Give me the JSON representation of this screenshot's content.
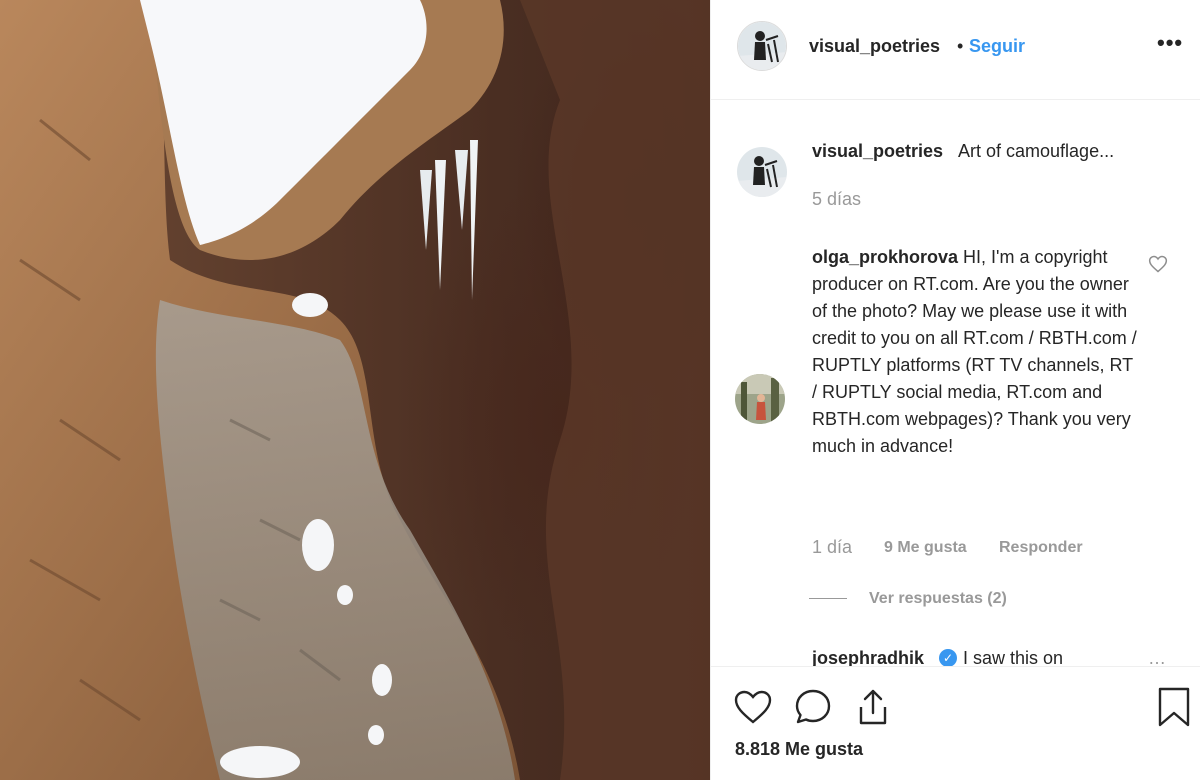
{
  "post": {
    "username": "visual_poetries",
    "separator": "•",
    "follow_label": "Seguir",
    "more_label": "•••"
  },
  "caption": {
    "username": "visual_poetries",
    "text": "Art of camouflage...",
    "time": "5 días"
  },
  "comment": {
    "username": "olga_prokhorova",
    "text": "HI, I'm a copyright producer on RT.com. Are you the owner of the photo? May we please use it with credit to you on all RT.com / RBTH.com / RUPTLY platforms (RT TV channels, RT / RUPTLY social media, RT.com and RBTH.com webpages)? Thank you very much in advance!",
    "time": "1 día",
    "likes": "9 Me gusta",
    "reply_label": "Responder",
    "view_replies": "Ver respuestas (2)"
  },
  "next_comment": {
    "username": "josephradhik",
    "text": "I saw this on",
    "more": "…"
  },
  "actions": {
    "likes_count": "8.818 Me gusta",
    "icons": [
      "heart-icon",
      "comment-icon",
      "share-icon",
      "bookmark-icon"
    ]
  },
  "colors": {
    "accent": "#3897f0",
    "text": "#262626",
    "muted": "#999999",
    "divider": "#efefef"
  }
}
